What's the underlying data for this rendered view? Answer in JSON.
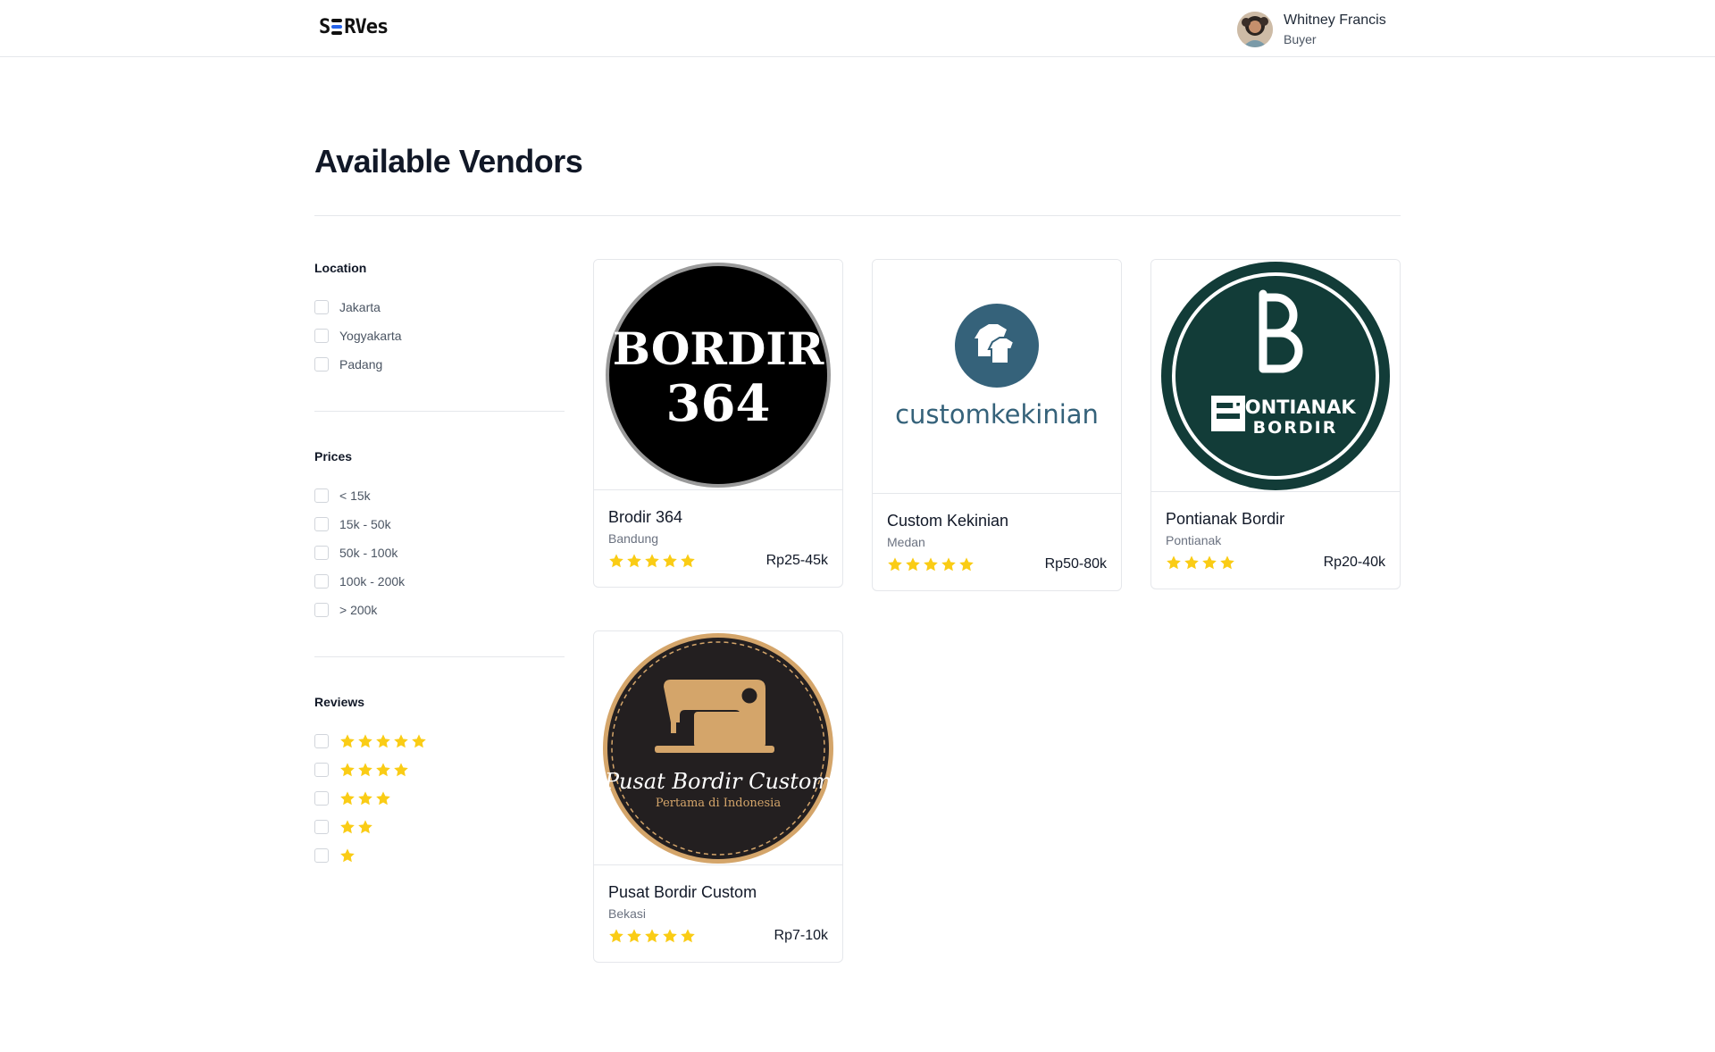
{
  "header": {
    "logo_s": "S",
    "logo_rest": "RVes",
    "user": {
      "name": "Whitney Francis",
      "role": "Buyer"
    }
  },
  "page": {
    "title": "Available Vendors"
  },
  "filters": {
    "location": {
      "title": "Location",
      "options": [
        "Jakarta",
        "Yogyakarta",
        "Padang"
      ]
    },
    "prices": {
      "title": "Prices",
      "options": [
        "< 15k",
        "15k - 50k",
        "50k - 100k",
        "100k - 200k",
        "> 200k"
      ]
    },
    "reviews": {
      "title": "Reviews",
      "options": [
        5,
        4,
        3,
        2,
        1
      ]
    }
  },
  "vendors": [
    {
      "name": "Brodir 364",
      "location": "Bandung",
      "price": "Rp25-45k",
      "rating": 5,
      "logo_text": [
        "BORDIR",
        "364"
      ]
    },
    {
      "name": "Custom Kekinian",
      "location": "Medan",
      "price": "Rp50-80k",
      "rating": 5,
      "logo_text": [
        "customkekinian"
      ]
    },
    {
      "name": "Pontianak Bordir",
      "location": "Pontianak",
      "price": "Rp20-40k",
      "rating": 4,
      "logo_text": [
        "PONTIANAK",
        "BORDIR"
      ]
    },
    {
      "name": "Pusat Bordir Custom",
      "location": "Bekasi",
      "price": "Rp7-10k",
      "rating": 5,
      "logo_text": [
        "Pusat Bordir Custom",
        "Pertama di Indonesia"
      ]
    }
  ],
  "colors": {
    "star": "#facc15",
    "accent": "#2563eb",
    "border": "#e5e7eb"
  }
}
